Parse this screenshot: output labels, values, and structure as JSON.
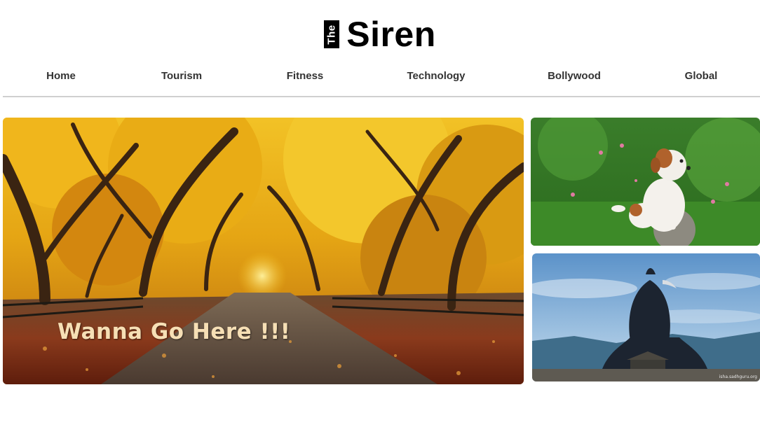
{
  "site": {
    "logo_prefix": "The",
    "logo_name": "Siren"
  },
  "nav": {
    "items": [
      {
        "label": "Home"
      },
      {
        "label": "Tourism"
      },
      {
        "label": "Fitness"
      },
      {
        "label": "Technology"
      },
      {
        "label": "Bollywood"
      },
      {
        "label": "Global"
      }
    ]
  },
  "featured": {
    "main_caption": "Wanna Go Here !!!",
    "statue_watermark": "isha.sadhguru.org"
  },
  "colors": {
    "accent_foliage": "#e8a512",
    "divider": "#cfcfcf",
    "caption": "#f6dfb5"
  }
}
